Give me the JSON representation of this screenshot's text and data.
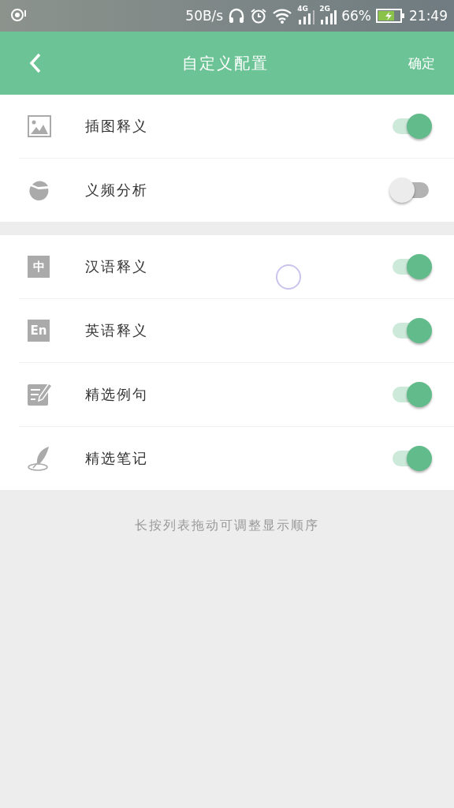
{
  "status_bar": {
    "speed": "50B/s",
    "network_1": "4G",
    "network_2": "2G",
    "battery": "66%",
    "time": "21:49"
  },
  "header": {
    "title": "自定义配置",
    "confirm": "确定"
  },
  "groups": [
    {
      "items": [
        {
          "kind": "picture",
          "label": "插图释义",
          "on": true
        },
        {
          "kind": "pie",
          "label": "义频分析",
          "on": false
        }
      ]
    },
    {
      "items": [
        {
          "kind": "badge",
          "badge": "中",
          "label": "汉语释义",
          "on": true
        },
        {
          "kind": "badge",
          "badge": "En",
          "label": "英语释义",
          "on": true
        },
        {
          "kind": "note",
          "label": "精选例句",
          "on": true
        },
        {
          "kind": "feather",
          "label": "精选笔记",
          "on": true
        }
      ]
    }
  ],
  "hint": "长按列表拖动可调整显示顺序"
}
